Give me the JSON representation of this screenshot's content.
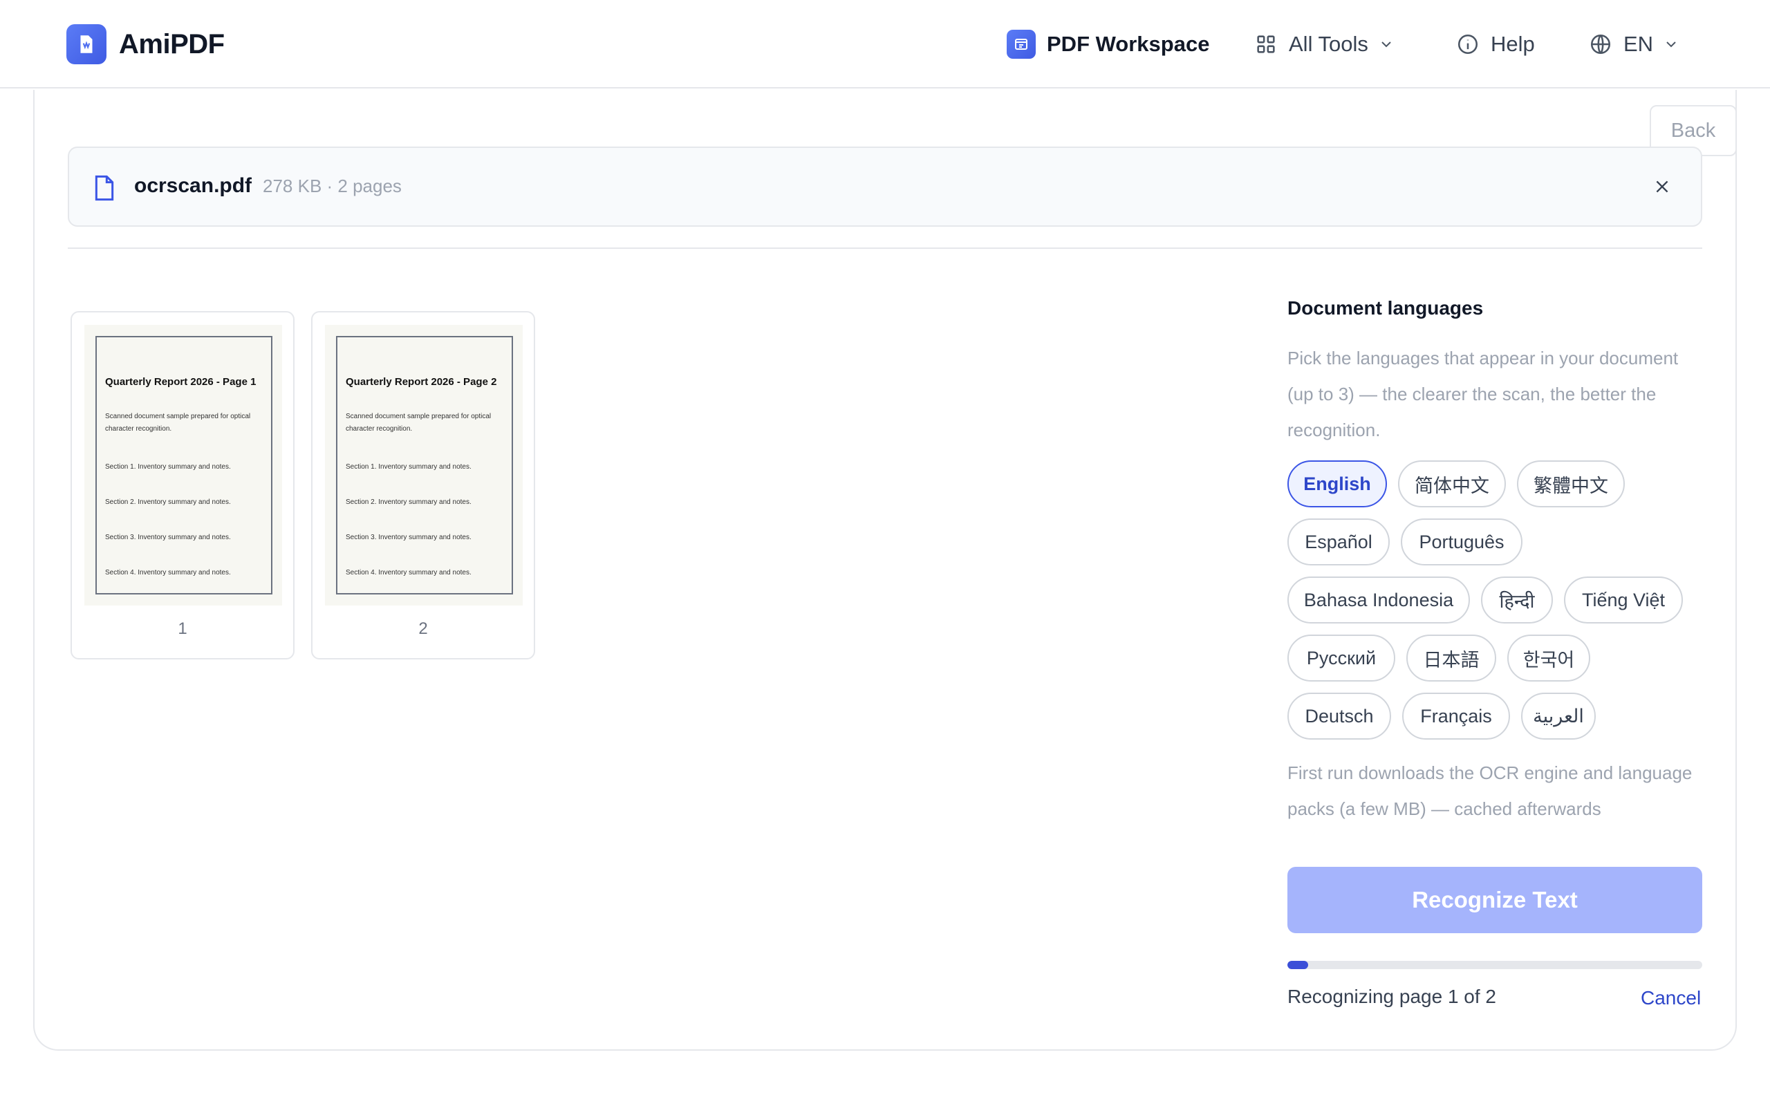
{
  "header": {
    "brand_name": "AmiPDF",
    "nav": {
      "workspace": "PDF Workspace",
      "all_tools": "All Tools",
      "help": "Help",
      "language": "EN"
    }
  },
  "toolbar": {
    "back_label": "Back"
  },
  "file": {
    "name": "ocrscan.pdf",
    "meta": "278 KB · 2 pages"
  },
  "thumbnails": [
    {
      "page_number": "1",
      "title": "Quarterly Report 2026 - Page 1",
      "subtitle": "Scanned document sample prepared for optical character recognition.",
      "sections": [
        "Section 1. Inventory summary and notes.",
        "Section 2. Inventory summary and notes.",
        "Section 3. Inventory summary and notes.",
        "Section 4. Inventory summary and notes."
      ]
    },
    {
      "page_number": "2",
      "title": "Quarterly Report 2026 - Page 2",
      "subtitle": "Scanned document sample prepared for optical character recognition.",
      "sections": [
        "Section 1. Inventory summary and notes.",
        "Section 2. Inventory summary and notes.",
        "Section 3. Inventory summary and notes.",
        "Section 4. Inventory summary and notes."
      ]
    }
  ],
  "panel": {
    "title": "Document languages",
    "description": "Pick the languages that appear in your document (up to 3) — the clearer the scan, the better the recognition.",
    "languages": [
      {
        "label": "English",
        "selected": true
      },
      {
        "label": "简体中文",
        "selected": false
      },
      {
        "label": "繁體中文",
        "selected": false
      },
      {
        "label": "Español",
        "selected": false
      },
      {
        "label": "Português",
        "selected": false
      },
      {
        "label": "Bahasa Indonesia",
        "selected": false
      },
      {
        "label": "हिन्दी",
        "selected": false
      },
      {
        "label": "Tiếng Việt",
        "selected": false
      },
      {
        "label": "Русский",
        "selected": false
      },
      {
        "label": "日本語",
        "selected": false
      },
      {
        "label": "한국어",
        "selected": false
      },
      {
        "label": "Deutsch",
        "selected": false
      },
      {
        "label": "Français",
        "selected": false
      },
      {
        "label": "العربية",
        "selected": false
      }
    ],
    "note": "First run downloads the OCR engine and language packs (a few MB) — cached afterwards",
    "recognize_label": "Recognize Text",
    "progress_fraction": 0.05,
    "status": "Recognizing page 1 of 2",
    "cancel_label": "Cancel"
  },
  "colors": {
    "accent": "#3b55e6",
    "accent_light": "#a5b4fc",
    "selected_bg": "#eef2ff"
  }
}
